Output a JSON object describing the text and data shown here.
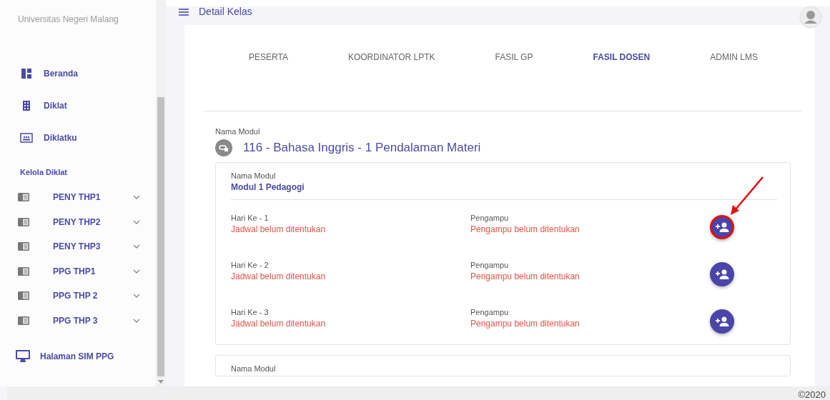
{
  "sidebar": {
    "brand": "Universitas Negeri Malang",
    "nav": [
      {
        "label": "Beranda",
        "kind": "dashboard"
      },
      {
        "label": "Diklat",
        "kind": "building"
      },
      {
        "label": "Diklatku",
        "kind": "classroom"
      }
    ],
    "section_title": "Kelola Diklat",
    "groups": [
      {
        "label": "PENY THP1",
        "expanded": false
      },
      {
        "label": "PENY THP2",
        "expanded": false
      },
      {
        "label": "PENY THP3",
        "expanded": false
      },
      {
        "label": "PPG THP1",
        "expanded": false
      },
      {
        "label": "PPG THP 2",
        "expanded": false
      },
      {
        "label": "PPG THP 3",
        "expanded": false
      }
    ],
    "footer_link": "Halaman SIM PPG"
  },
  "topbar": {
    "title": "Detail Kelas"
  },
  "tabs": [
    {
      "label": "PESERTA",
      "selected": false
    },
    {
      "label": "KOORDINATOR LPTK",
      "selected": false
    },
    {
      "label": "FASIL GP",
      "selected": false
    },
    {
      "label": "FASIL DOSEN",
      "selected": true
    },
    {
      "label": "ADMIN LMS",
      "selected": false
    }
  ],
  "course": {
    "label": "Nama Modul",
    "title": "116 - Bahasa Inggris - 1  Pendalaman Materi"
  },
  "modules": [
    {
      "label": "Nama Modul",
      "name": "Modul 1 Pedagogi",
      "days": [
        {
          "day": "Hari Ke - 1",
          "schedule": "Jadwal belum ditentukan",
          "lecturer_label": "Pengampu",
          "lecturer": "Pengampu belum ditentukan",
          "highlighted": true
        },
        {
          "day": "Hari Ke - 2",
          "schedule": "Jadwal belum ditentukan",
          "lecturer_label": "Pengampu",
          "lecturer": "Pengampu belum ditentukan",
          "highlighted": false
        },
        {
          "day": "Hari Ke - 3",
          "schedule": "Jadwal belum ditentukan",
          "lecturer_label": "Pengampu",
          "lecturer": "Pengampu belum ditentukan",
          "highlighted": false
        }
      ]
    },
    {
      "label": "Nama Modul"
    }
  ],
  "footer": {
    "copyright": "©2020"
  }
}
